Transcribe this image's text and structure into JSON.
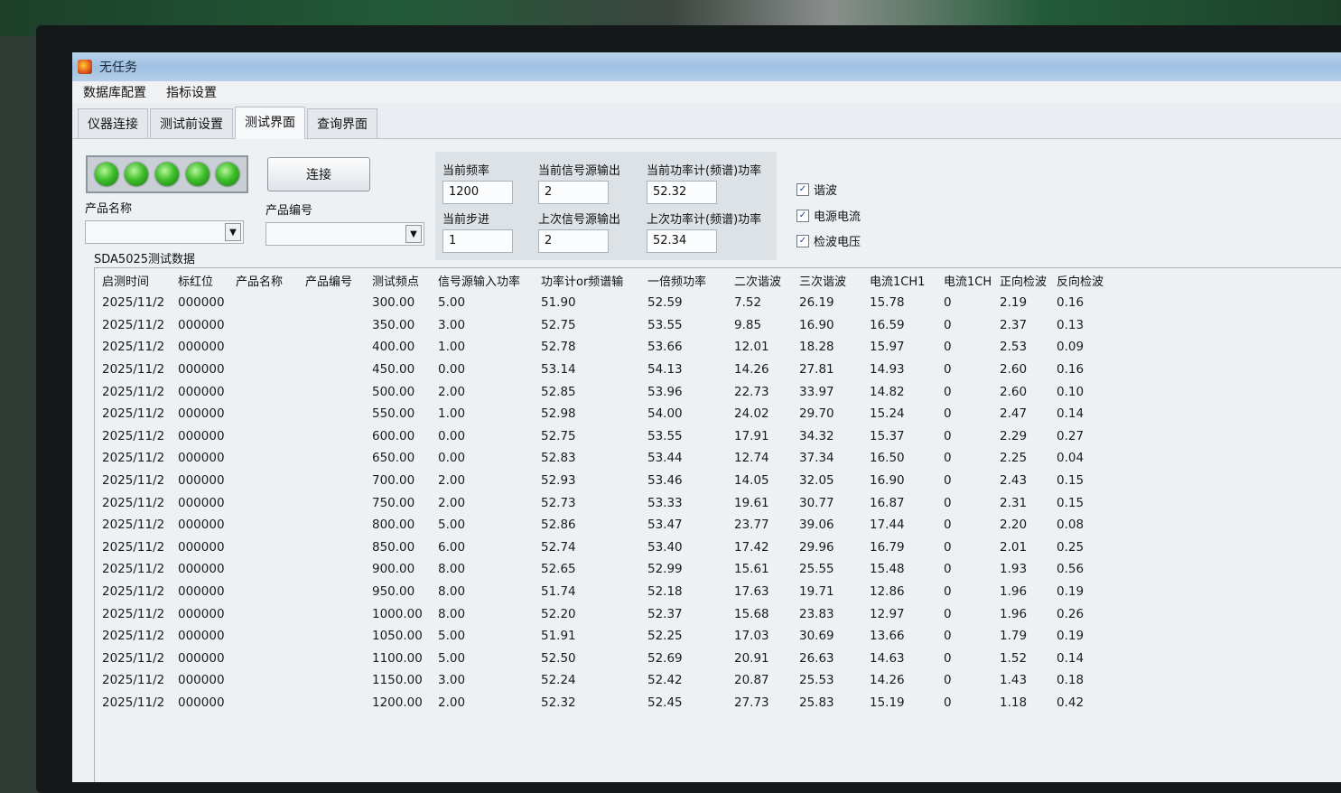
{
  "window": {
    "title": "无任务"
  },
  "menu": [
    "数据库配置",
    "指标设置"
  ],
  "tabs": [
    {
      "label": "仪器连接",
      "active": false
    },
    {
      "label": "测试前设置",
      "active": false
    },
    {
      "label": "测试界面",
      "active": true
    },
    {
      "label": "查询界面",
      "active": false
    }
  ],
  "status_leds": {
    "count": 5,
    "color": "#3fbf2c"
  },
  "connect_button": "连接",
  "product": {
    "name_label": "产品名称",
    "name_value": "",
    "number_label": "产品编号",
    "number_value": ""
  },
  "fields": {
    "current_freq_label": "当前频率",
    "current_freq": "1200",
    "current_step_label": "当前步进",
    "current_step": "1",
    "current_source_label": "当前信号源输出",
    "current_source": "2",
    "last_source_label": "上次信号源输出",
    "last_source": "2",
    "current_power_label": "当前功率计(频谱)功率",
    "current_power": "52.32",
    "last_power_label": "上次功率计(频谱)功率",
    "last_power": "52.34"
  },
  "checkboxes": [
    {
      "label": "谐波",
      "checked": true
    },
    {
      "label": "电源电流",
      "checked": true
    },
    {
      "label": "检波电压",
      "checked": true
    }
  ],
  "grid": {
    "title": "SDA5025测试数据",
    "columns": [
      "启测时间",
      "标红位",
      "产品名称",
      "产品编号",
      "测试频点",
      "信号源输入功率",
      "功率计or频谱输",
      "一倍频功率",
      "二次谐波",
      "三次谐波",
      "电流1CH1",
      "电流1CH",
      "正向检波",
      "反向检波"
    ],
    "rows": [
      [
        "2025/11/2",
        "000000",
        "",
        "",
        "300.00",
        "5.00",
        "51.90",
        "52.59",
        "7.52",
        "26.19",
        "15.78",
        "0",
        "2.19",
        "0.16"
      ],
      [
        "2025/11/2",
        "000000",
        "",
        "",
        "350.00",
        "3.00",
        "52.75",
        "53.55",
        "9.85",
        "16.90",
        "16.59",
        "0",
        "2.37",
        "0.13"
      ],
      [
        "2025/11/2",
        "000000",
        "",
        "",
        "400.00",
        "1.00",
        "52.78",
        "53.66",
        "12.01",
        "18.28",
        "15.97",
        "0",
        "2.53",
        "0.09"
      ],
      [
        "2025/11/2",
        "000000",
        "",
        "",
        "450.00",
        "0.00",
        "53.14",
        "54.13",
        "14.26",
        "27.81",
        "14.93",
        "0",
        "2.60",
        "0.16"
      ],
      [
        "2025/11/2",
        "000000",
        "",
        "",
        "500.00",
        "2.00",
        "52.85",
        "53.96",
        "22.73",
        "33.97",
        "14.82",
        "0",
        "2.60",
        "0.10"
      ],
      [
        "2025/11/2",
        "000000",
        "",
        "",
        "550.00",
        "1.00",
        "52.98",
        "54.00",
        "24.02",
        "29.70",
        "15.24",
        "0",
        "2.47",
        "0.14"
      ],
      [
        "2025/11/2",
        "000000",
        "",
        "",
        "600.00",
        "0.00",
        "52.75",
        "53.55",
        "17.91",
        "34.32",
        "15.37",
        "0",
        "2.29",
        "0.27"
      ],
      [
        "2025/11/2",
        "000000",
        "",
        "",
        "650.00",
        "0.00",
        "52.83",
        "53.44",
        "12.74",
        "37.34",
        "16.50",
        "0",
        "2.25",
        "0.04"
      ],
      [
        "2025/11/2",
        "000000",
        "",
        "",
        "700.00",
        "2.00",
        "52.93",
        "53.46",
        "14.05",
        "32.05",
        "16.90",
        "0",
        "2.43",
        "0.15"
      ],
      [
        "2025/11/2",
        "000000",
        "",
        "",
        "750.00",
        "2.00",
        "52.73",
        "53.33",
        "19.61",
        "30.77",
        "16.87",
        "0",
        "2.31",
        "0.15"
      ],
      [
        "2025/11/2",
        "000000",
        "",
        "",
        "800.00",
        "5.00",
        "52.86",
        "53.47",
        "23.77",
        "39.06",
        "17.44",
        "0",
        "2.20",
        "0.08"
      ],
      [
        "2025/11/2",
        "000000",
        "",
        "",
        "850.00",
        "6.00",
        "52.74",
        "53.40",
        "17.42",
        "29.96",
        "16.79",
        "0",
        "2.01",
        "0.25"
      ],
      [
        "2025/11/2",
        "000000",
        "",
        "",
        "900.00",
        "8.00",
        "52.65",
        "52.99",
        "15.61",
        "25.55",
        "15.48",
        "0",
        "1.93",
        "0.56"
      ],
      [
        "2025/11/2",
        "000000",
        "",
        "",
        "950.00",
        "8.00",
        "51.74",
        "52.18",
        "17.63",
        "19.71",
        "12.86",
        "0",
        "1.96",
        "0.19"
      ],
      [
        "2025/11/2",
        "000000",
        "",
        "",
        "1000.00",
        "8.00",
        "52.20",
        "52.37",
        "15.68",
        "23.83",
        "12.97",
        "0",
        "1.96",
        "0.26"
      ],
      [
        "2025/11/2",
        "000000",
        "",
        "",
        "1050.00",
        "5.00",
        "51.91",
        "52.25",
        "17.03",
        "30.69",
        "13.66",
        "0",
        "1.79",
        "0.19"
      ],
      [
        "2025/11/2",
        "000000",
        "",
        "",
        "1100.00",
        "5.00",
        "52.50",
        "52.69",
        "20.91",
        "26.63",
        "14.63",
        "0",
        "1.52",
        "0.14"
      ],
      [
        "2025/11/2",
        "000000",
        "",
        "",
        "1150.00",
        "3.00",
        "52.24",
        "52.42",
        "20.87",
        "25.53",
        "14.26",
        "0",
        "1.43",
        "0.18"
      ],
      [
        "2025/11/2",
        "000000",
        "",
        "",
        "1200.00",
        "2.00",
        "52.32",
        "52.45",
        "27.73",
        "25.83",
        "15.19",
        "0",
        "1.18",
        "0.42"
      ]
    ]
  }
}
